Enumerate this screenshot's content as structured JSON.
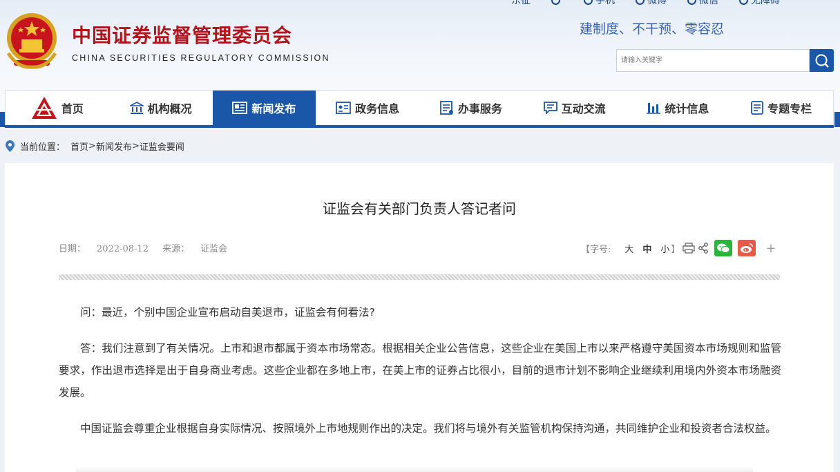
{
  "header": {
    "top_links": [
      {
        "label": "东征",
        "icon": "home-icon"
      },
      {
        "label": "",
        "icon": "phone-icon"
      },
      {
        "label": "手机",
        "icon": "mobile-icon"
      },
      {
        "label": "微博",
        "icon": "weibo-icon"
      },
      {
        "label": "微信",
        "icon": "wechat-icon"
      },
      {
        "label": "无障碍",
        "icon": "accessibility-icon"
      }
    ],
    "site_name": "中国证券监督管理委员会",
    "site_name_en": "CHINA SECURITIES REGULATORY COMMISSION",
    "slogan": "建制度、不干预、零容忍",
    "search": {
      "placeholder": "请输入关键字"
    }
  },
  "nav": {
    "items": [
      {
        "label": "首页",
        "icon": "csrc-logo-icon",
        "active": false
      },
      {
        "label": "机构概况",
        "icon": "institution-icon",
        "active": false
      },
      {
        "label": "新闻发布",
        "icon": "news-icon",
        "active": true
      },
      {
        "label": "政务信息",
        "icon": "government-info-icon",
        "active": false
      },
      {
        "label": "办事服务",
        "icon": "service-icon",
        "active": false
      },
      {
        "label": "互动交流",
        "icon": "chat-icon",
        "active": false
      },
      {
        "label": "统计信息",
        "icon": "bar-chart-icon",
        "active": false
      },
      {
        "label": "专题专栏",
        "icon": "topic-icon",
        "active": false
      }
    ]
  },
  "breadcrumb": {
    "prefix": "当前位置：",
    "items": [
      "首页",
      "新闻发布",
      "证监会要闻"
    ],
    "sep": ">"
  },
  "article": {
    "title": "证监会有关部门负责人答记者问",
    "date_label": "日期：",
    "date": "2022-08-12",
    "source_label": "来源：",
    "source": "证监会",
    "font_size_label": "【字号:",
    "font_large": "大",
    "font_medium": "中",
    "font_small": "小",
    "font_end": "】",
    "paragraphs": [
      "问：最近，个别中国企业宣布启动自美退市，证监会有何看法?",
      "答：我们注意到了有关情况。上市和退市都属于资本市场常态。根据相关企业公告信息，这些企业在美国上市以来严格遵守美国资本市场规则和监管要求，作出退市选择是出于自身商业考虑。这些企业都在多地上市，在美上市的证券占比很小，目前的退市计划不影响企业继续利用境内外资本市场融资发展。",
      "中国证监会尊重企业根据自身实际情况、按照境外上市地规则作出的决定。我们将与境外有关监管机构保持沟通，共同维护企业和投资者合法权益。"
    ]
  },
  "colors": {
    "brand_red": "#b3141a",
    "brand_blue": "#1b57a8"
  }
}
